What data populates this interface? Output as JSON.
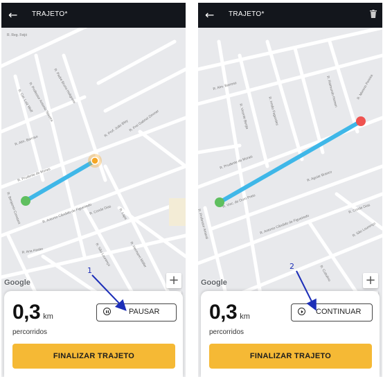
{
  "screens": [
    {
      "topbar": {
        "title": "TRAJETO*",
        "back_icon": "arrow-left-icon"
      },
      "map": {
        "streets": [
          "R. Reg. Feijó",
          "R. Cel. Luiz Wolf",
          "R. Professor Antonio Teixeira",
          "R. Padre Bruno Holtgreve",
          "R. Aldo Carvalho",
          "R. Prof. João Bley",
          "R. Frei Gabriel Zimmer",
          "R. Alm. Barroso",
          "R. Tiradentes",
          "R. Prudente de Morais",
          "R. Benjamin Constant",
          "R. Antonio Cândido de Figueiredo",
          "R. Conde Dias",
          "R. Lapa",
          "R. São Lourenço",
          "R. Jarbas Lilly",
          "R. Hermann Möller",
          "R. Cuitulino",
          "R. Ana Hasler"
        ],
        "google_label": "Google",
        "zoom_in": "+",
        "zoom_out": "−"
      },
      "panel": {
        "distance": "0,3",
        "unit": "km",
        "sub": "percorridos",
        "control_label": "PAUSAR",
        "control_icon": "pause-icon",
        "finish_label": "FINALIZAR TRAJETO"
      },
      "annotation": "1"
    },
    {
      "topbar": {
        "title": "TRAJETO*",
        "back_icon": "arrow-left-icon",
        "trash_icon": "trash-icon"
      },
      "map": {
        "streets": [
          "R. Alm. Barroso",
          "R. Vicente Berga",
          "R. Irmão Fagundes",
          "R. Raimundo Homen",
          "R. Moreno Pereira",
          "R. Prudente de Morais",
          "R. Aguiar Branco",
          "R. Visc. de Ouro Preto",
          "R. Antonio Cândido de Figueiredo",
          "R. Conde Dias",
          "R. São Lourenço",
          "R. Cuitulino",
          "R. Professor Amaral"
        ],
        "google_label": "Google",
        "zoom_in": "+",
        "zoom_out": "−"
      },
      "panel": {
        "distance": "0,3",
        "unit": "km",
        "sub": "percorridos",
        "control_label": "CONTINUAR",
        "control_icon": "play-icon",
        "finish_label": "FINALIZAR TRAJETO"
      },
      "annotation": "2"
    }
  ],
  "colors": {
    "topbar": "#13161c",
    "accent": "#f5b935",
    "route": "#3fb7e8",
    "start_point": "#5fbf5f",
    "end_point": "#ef5350",
    "current_position": "#f5a623",
    "annotation": "#1d2fb8"
  }
}
